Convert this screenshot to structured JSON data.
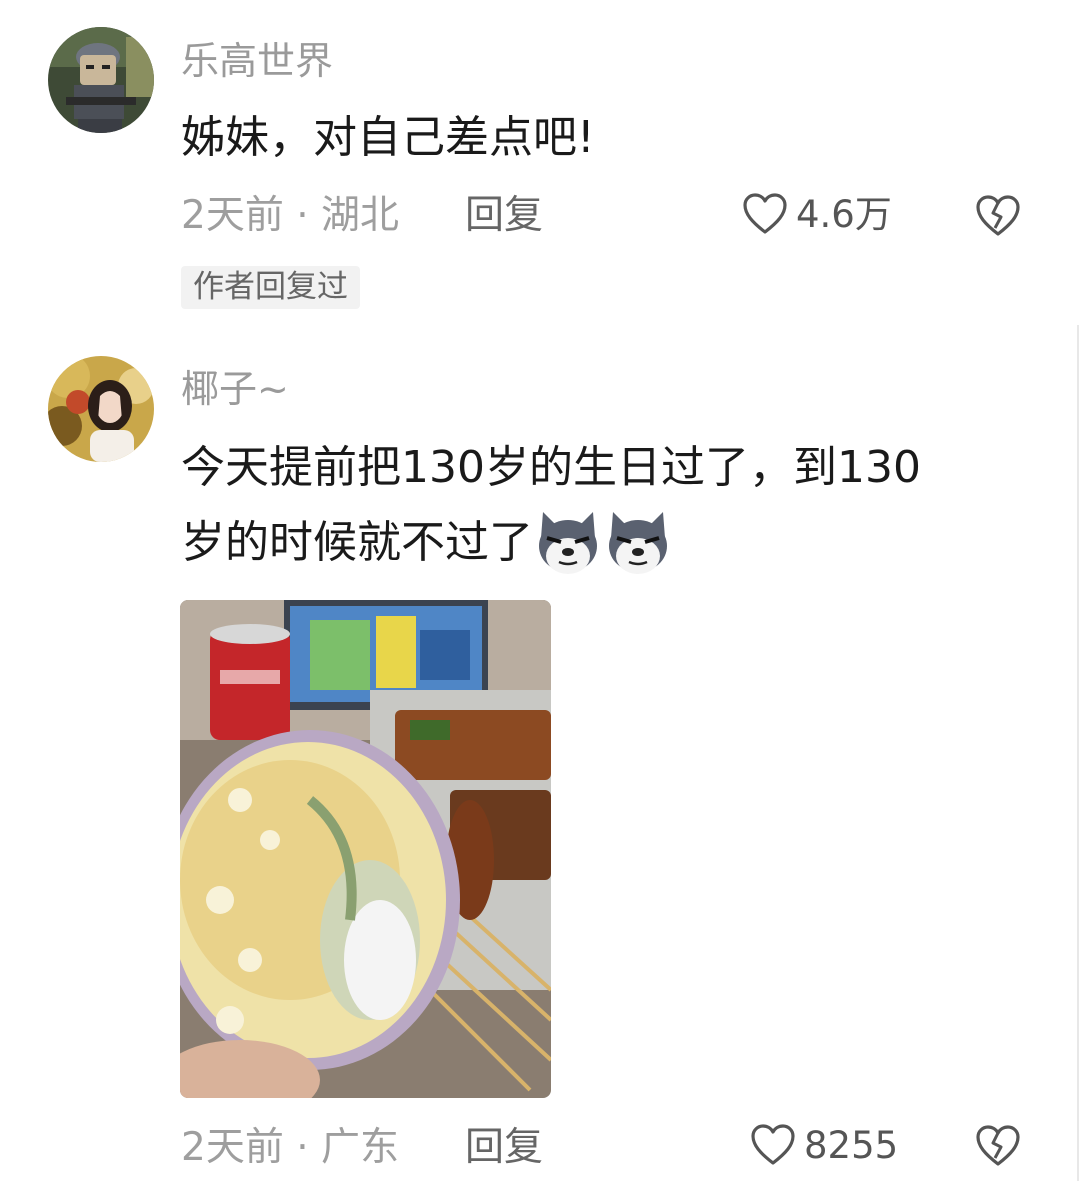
{
  "comments": [
    {
      "username": "乐高世界",
      "text": "姊妹，对自己差点吧!",
      "time_location": "2天前 · 湖北",
      "reply_label": "回复",
      "like_count": "4.6万",
      "author_tag": "作者回复过",
      "avatar": "lego-soldier-avatar"
    },
    {
      "username": "椰子~",
      "text_line1": "今天提前把130岁的生日过了，到130",
      "text_line2": "岁的时候就不过了",
      "emoji": "dog-smirk-emoji",
      "time_location": "2天前 · 广东",
      "reply_label": "回复",
      "like_count": "8255",
      "avatar": "girl-portrait-avatar",
      "image": "cake-and-skewers-photo"
    }
  ],
  "icons": {
    "like": "heart-outline-icon",
    "dislike": "broken-heart-icon"
  },
  "colors": {
    "username": "#9a9a9a",
    "meta": "#9e9e9e",
    "text": "#1a1a1a",
    "tag_bg": "#f2f2f2"
  }
}
